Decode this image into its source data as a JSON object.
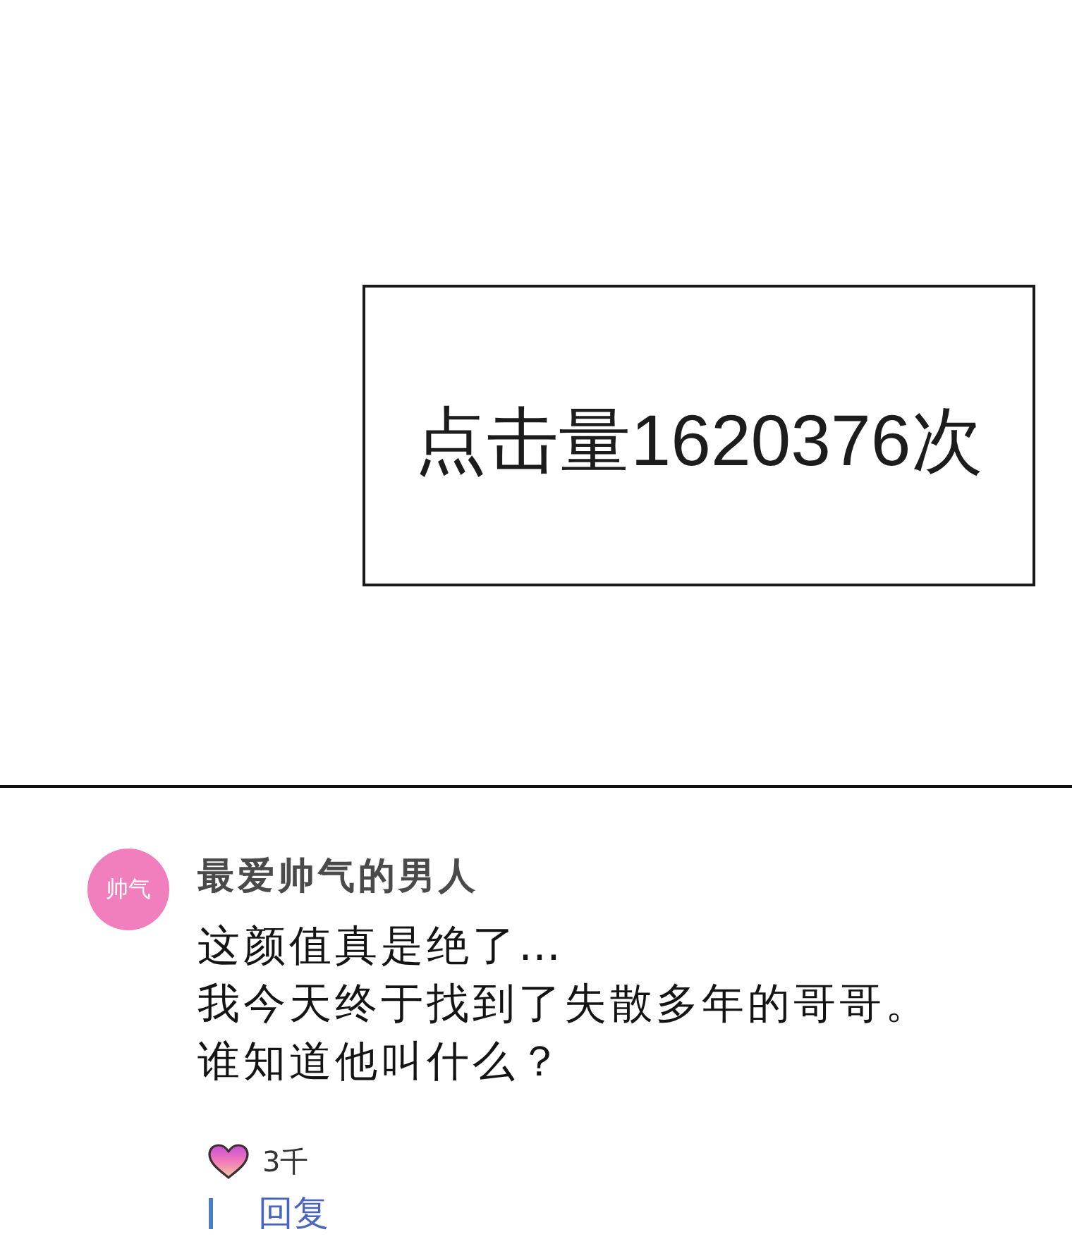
{
  "banner": {
    "text": "点击量1620376次"
  },
  "comments": [
    {
      "avatar_text": "帅气",
      "username": "最爱帅气的男人",
      "lines": [
        "这颜值真是绝了…",
        "我今天终于找到了失散多年的哥哥。",
        "谁知道他叫什么？"
      ],
      "likes": "3千",
      "reply": "回复"
    }
  ]
}
